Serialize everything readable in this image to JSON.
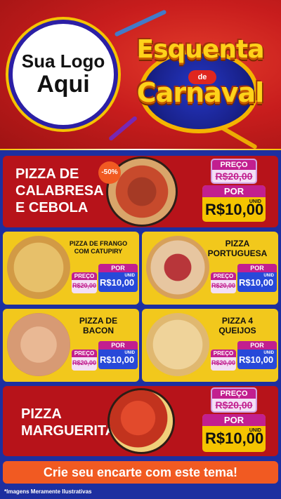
{
  "header": {
    "logo_line1": "Sua Logo",
    "logo_line2": "Aqui",
    "title_line1": "Esquenta",
    "title_connector": "de",
    "title_line2": "Carnaval"
  },
  "featured": [
    {
      "name_line1": "PIZZA DE",
      "name_line2": "CALABRESA",
      "name_line3": "E CEBOLA",
      "badge": "-50%",
      "old_label": "PREÇO",
      "old_price": "R$20,00",
      "new_label": "POR",
      "unit": "UNID",
      "new_price": "R$10,00"
    },
    {
      "name_line1": "PIZZA",
      "name_line2": "MARGUERITA",
      "old_label": "PREÇO",
      "old_price": "R$20,00",
      "new_label": "POR",
      "unit": "UNID",
      "new_price": "R$10,00"
    }
  ],
  "items": [
    {
      "name_line1": "PIZZA DE FRANGO",
      "name_line2": "COM CATUPIRY",
      "old_label": "PREÇO",
      "old_price": "R$20,00",
      "new_label": "POR",
      "unit": "UNID",
      "new_price": "R$10,00"
    },
    {
      "name_line1": "PIZZA",
      "name_line2": "PORTUGUESA",
      "old_label": "PREÇO",
      "old_price": "R$20,00",
      "new_label": "POR",
      "unit": "UNID",
      "new_price": "R$10,00"
    },
    {
      "name_line1": "PIZZA DE",
      "name_line2": "BACON",
      "old_label": "PREÇO",
      "old_price": "R$20,00",
      "new_label": "POR",
      "unit": "UNID",
      "new_price": "R$10,00"
    },
    {
      "name_line1": "PIZZA 4",
      "name_line2": "QUEIJOS",
      "old_label": "PREÇO",
      "old_price": "R$20,00",
      "new_label": "POR",
      "unit": "UNID",
      "new_price": "R$10,00"
    }
  ],
  "cta": "Crie seu encarte com este tema!",
  "footnote": "*Imagens Meramente Ilustrativas",
  "colors": {
    "header_red": "#c81d1d",
    "card_red": "#b7131a",
    "card_yellow": "#f2c81c",
    "accent_magenta": "#c21f8f",
    "price_blue": "#2749d9",
    "cta_orange": "#f15a22",
    "background_blue": "#1d2fa0"
  }
}
